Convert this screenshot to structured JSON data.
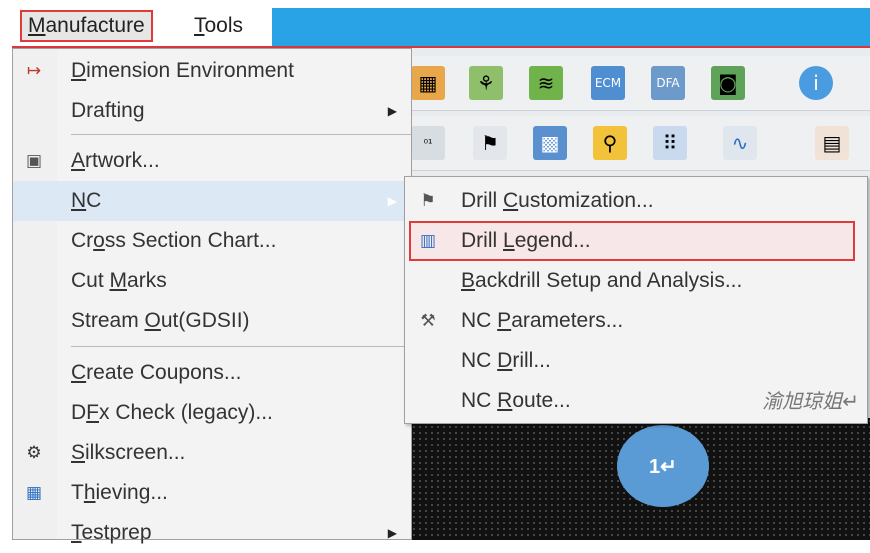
{
  "menubar": {
    "items": [
      {
        "label_key": "M",
        "label_rest": "anufacture"
      },
      {
        "label_key": "T",
        "label_rest": "ools"
      }
    ]
  },
  "manufacture_menu": {
    "items": [
      {
        "pre": "",
        "key": "D",
        "post": "imension Environment",
        "icon": "dimension-icon",
        "submenu": false
      },
      {
        "pre": "Drafting",
        "key": "",
        "post": "",
        "icon": "",
        "submenu": true
      },
      {
        "pre": "",
        "key": "A",
        "post": "rtwork...",
        "icon": "artwork-icon",
        "submenu": false
      },
      {
        "pre": "",
        "key": "N",
        "post": "C",
        "icon": "",
        "submenu": true
      },
      {
        "pre": "Cr",
        "key": "o",
        "post": "ss Section Chart...",
        "icon": "",
        "submenu": false
      },
      {
        "pre": "Cut ",
        "key": "M",
        "post": "arks",
        "icon": "",
        "submenu": false
      },
      {
        "pre": "Stream ",
        "key": "O",
        "post": "ut(GDSII)",
        "icon": "",
        "submenu": false
      },
      {
        "pre": "",
        "key": "C",
        "post": "reate Coupons...",
        "icon": "",
        "submenu": false
      },
      {
        "pre": "D",
        "key": "F",
        "post": "x Check (legacy)...",
        "icon": "",
        "submenu": false
      },
      {
        "pre": "",
        "key": "S",
        "post": "ilkscreen...",
        "icon": "silkscreen-icon",
        "submenu": false
      },
      {
        "pre": "T",
        "key": "h",
        "post": "ieving...",
        "icon": "thieving-icon",
        "submenu": false
      },
      {
        "pre": "",
        "key": "T",
        "post": "estprep",
        "icon": "",
        "submenu": true
      }
    ]
  },
  "nc_submenu": {
    "items": [
      {
        "pre": "Drill ",
        "key": "C",
        "post": "ustomization...",
        "icon": "drill-customization-icon"
      },
      {
        "pre": "Drill ",
        "key": "L",
        "post": "egend...",
        "icon": "drill-legend-icon"
      },
      {
        "pre": "",
        "key": "B",
        "post": "ackdrill Setup and Analysis...",
        "icon": ""
      },
      {
        "pre": "NC ",
        "key": "P",
        "post": "arameters...",
        "icon": "nc-parameters-icon"
      },
      {
        "pre": "NC ",
        "key": "D",
        "post": "rill...",
        "icon": ""
      },
      {
        "pre": "NC ",
        "key": "R",
        "post": "oute...",
        "icon": ""
      }
    ],
    "watermark": "渝旭琼姐↵"
  },
  "badge": {
    "text": "1↵"
  },
  "colors": {
    "titlebar_blue": "#29a3e6",
    "highlight_red": "#e03a3a",
    "badge_blue": "#5b9bd5"
  }
}
